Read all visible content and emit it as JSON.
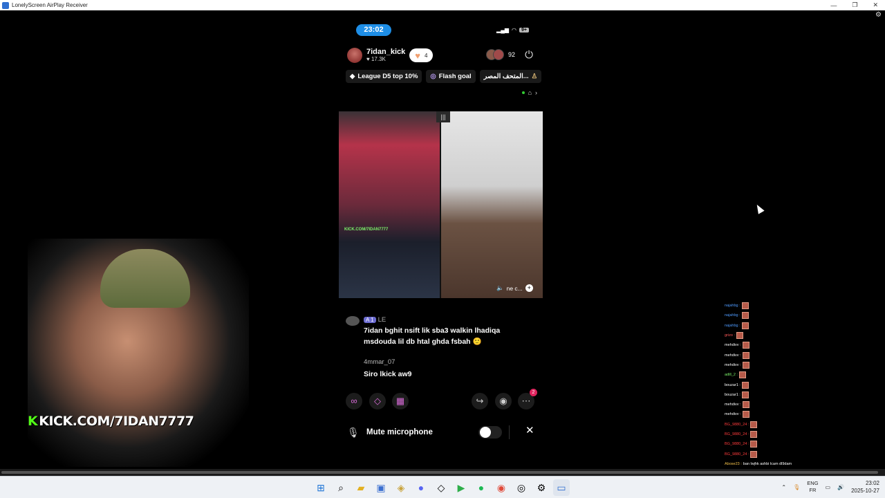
{
  "window": {
    "title": "LonelyScreen AirPlay Receiver",
    "minimize": "—",
    "maximize": "❐",
    "close": "✕"
  },
  "phone": {
    "time": "23:02",
    "battery": "9+",
    "host": {
      "name": "7idan_kick",
      "likes": "17.3K",
      "follow_count": "4"
    },
    "viewer_count": "92",
    "chips": [
      {
        "icon": "diamond-icon",
        "label": "League D5 top 10%"
      },
      {
        "icon": "target-icon",
        "label": "Flash goal"
      },
      {
        "icon": "arabic-tag",
        "label": "المتحف المصر..."
      }
    ],
    "video": {
      "left_overlay_url": "KICK.COM/7IDAN7777",
      "right_tag": "ne c..."
    },
    "comments": [
      {
        "name": "LE",
        "badge": "A 1",
        "text": "7idan bghit nsift lik sba3 walkin lhadiqa msdouda lil db htal ghda fsbah 🙂"
      },
      {
        "name": "4mmar_07",
        "text": "Siro lkick aw9"
      }
    ],
    "action_badge": "2",
    "mute": {
      "label": "Mute microphone"
    }
  },
  "webcam": {
    "overlay_prefix": "K",
    "overlay_url": "KICK.COM/7IDAN7777"
  },
  "overlay_chat": [
    {
      "user": "najahbg :",
      "color": "#4f9bff"
    },
    {
      "user": "najahbg :",
      "color": "#4f9bff"
    },
    {
      "user": "najahbg :",
      "color": "#4f9bff"
    },
    {
      "user": "grizo :",
      "color": "#ff5a5a"
    },
    {
      "user": "mehdivv :",
      "color": "#ffffff"
    },
    {
      "user": "mehdivv :",
      "color": "#ffffff"
    },
    {
      "user": "mehdivv :",
      "color": "#ffffff"
    },
    {
      "user": "adill_2 :",
      "color": "#7cf36a"
    },
    {
      "user": "bouzar1 :",
      "color": "#ffffff"
    },
    {
      "user": "bouzar1 :",
      "color": "#ffffff"
    },
    {
      "user": "mehdivv :",
      "color": "#ffffff"
    },
    {
      "user": "mehdivv :",
      "color": "#ffffff"
    },
    {
      "user": "BG_9880_24 :",
      "color": "#ff3b3b"
    },
    {
      "user": "BG_9880_24 :",
      "color": "#ff3b3b"
    },
    {
      "user": "BG_9880_24 :",
      "color": "#ff3b3b"
    },
    {
      "user": "BG_9880_24 :",
      "color": "#ff3b3b"
    }
  ],
  "overlay_chat_last": {
    "user": "Abose23 :",
    "text": "ban lwjhk ashbi lcam dl9dam"
  },
  "taskbar": {
    "apps": [
      "start-icon",
      "search-icon",
      "file-explorer-icon",
      "store-icon",
      "app-icon",
      "discord-icon",
      "capcut-icon",
      "play-icon",
      "spotify-icon",
      "chrome-icon",
      "obs-icon",
      "settings-icon",
      "lonelyscreen-icon"
    ],
    "lang_top": "ENG",
    "lang_bottom": "FR",
    "time": "23:02",
    "date": "2025-10-27"
  }
}
